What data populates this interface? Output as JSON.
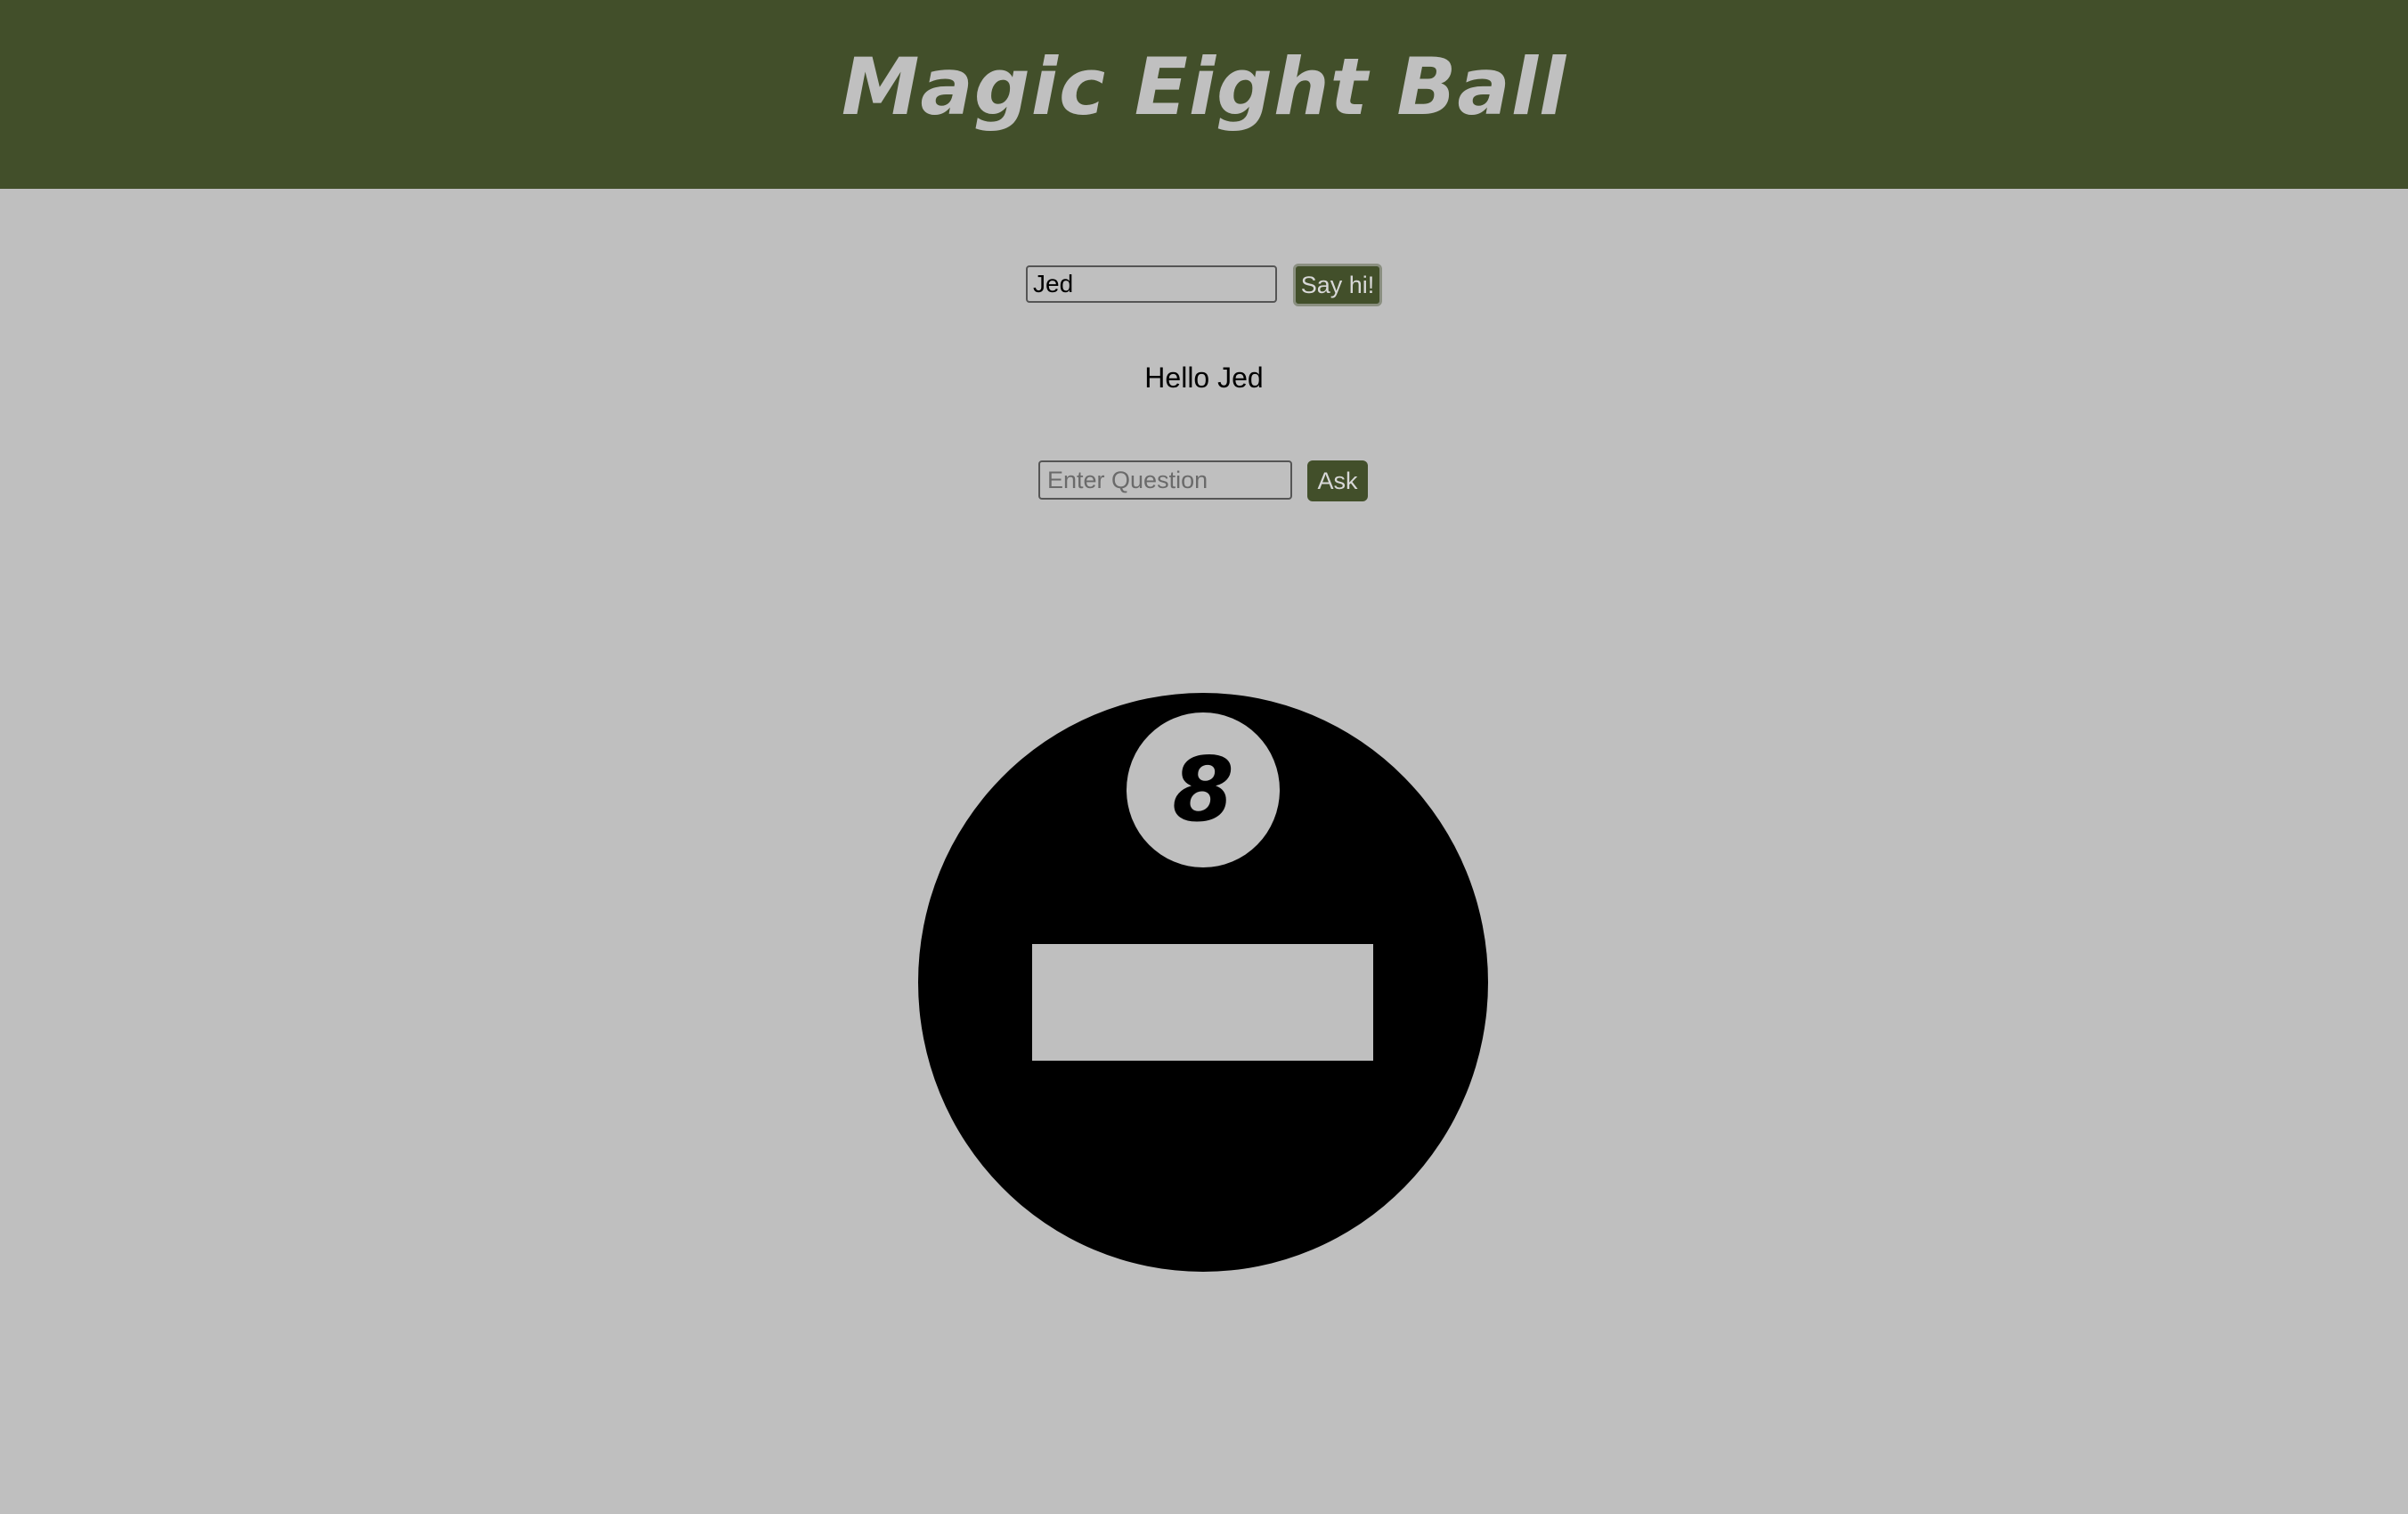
{
  "header": {
    "title": "Magic Eight Ball"
  },
  "greeting_form": {
    "name_value": "Jed",
    "button_label": "Say hi!"
  },
  "greeting": {
    "text": "Hello Jed"
  },
  "question_form": {
    "placeholder": "Enter Question",
    "value": "",
    "button_label": "Ask"
  },
  "eight_ball": {
    "number": "8",
    "answer": ""
  },
  "colors": {
    "header_bg": "#424f2a",
    "page_bg": "#bfbfbf",
    "title_text": "#c0c0c0",
    "ball": "#000000"
  }
}
